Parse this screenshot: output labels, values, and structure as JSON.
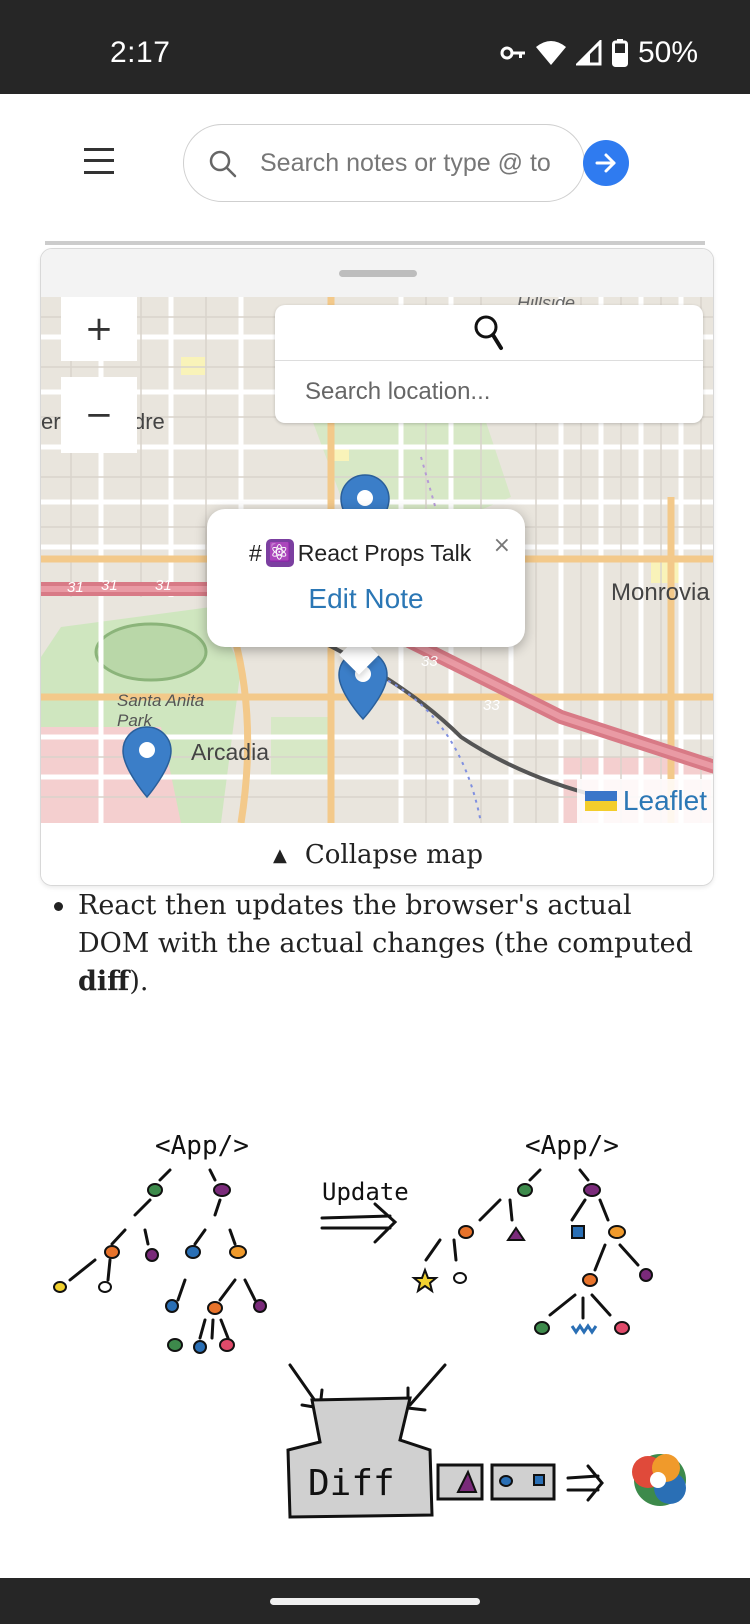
{
  "status_bar": {
    "time": "2:17",
    "battery": "50%"
  },
  "header": {
    "search_placeholder": "Search notes or type @ to",
    "go_icon": "arrow-right-icon"
  },
  "map": {
    "location_search_placeholder": "Search location...",
    "zoom_in_label": "+",
    "zoom_out_label": "−",
    "labels": {
      "label_1": "er",
      "label_2": "dre",
      "label_3": "Monrovia",
      "label_4": "Santa Anita Park",
      "label_5": "Arcadia",
      "label_6": "Hillside"
    },
    "highway_labels": [
      "31",
      "31",
      "31",
      "33",
      "33"
    ],
    "popup": {
      "hash": "#",
      "emoji": "⚛️",
      "title": "React Props Talk",
      "close": "×",
      "link": "Edit Note"
    },
    "attribution": "Leaflet",
    "collapse_label": "Collapse map",
    "collapse_arrow": "▲"
  },
  "content": {
    "bullet_text_before": "React then updates the browser's actual DOM with the actual changes (the computed ",
    "bullet_bold": "diff",
    "bullet_text_after": ")."
  },
  "illustration": {
    "app_label_left": "<App/>",
    "app_label_right": "<App/>",
    "update_label": "Update",
    "diff_label": "Diff"
  },
  "colors": {
    "status_bar_bg": "#262626",
    "go_button": "#2f7bf0",
    "marker": "#3b7ec8",
    "link": "#2b77b5"
  }
}
